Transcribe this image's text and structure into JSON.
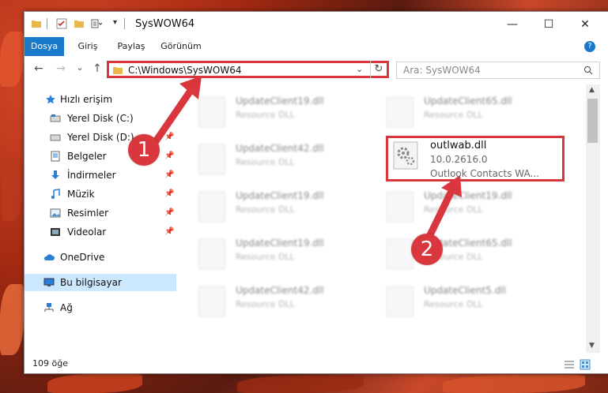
{
  "window": {
    "title": "SysWOW64",
    "controls": {
      "minimize": "—",
      "maximize": "☐",
      "close": "✕"
    }
  },
  "ribbon": {
    "tabs": [
      {
        "label": "Dosya",
        "active": true
      },
      {
        "label": "Giriş"
      },
      {
        "label": "Paylaş"
      },
      {
        "label": "Görünüm"
      }
    ],
    "help": "?"
  },
  "navigation": {
    "back": "←",
    "forward": "→",
    "recent": "⌄",
    "up": "↑",
    "address": "C:\\Windows\\SysWOW64",
    "dropdown": "⌄",
    "refresh": "↻",
    "search_placeholder": "Ara: SysWOW64"
  },
  "sidebar": {
    "items": [
      {
        "label": "Hızlı erişim",
        "icon": "star-icon"
      },
      {
        "label": "Yerel Disk (C:)",
        "icon": "drive-icon"
      },
      {
        "label": "Yerel Disk (D:)",
        "icon": "drive-icon"
      },
      {
        "label": "Belgeler",
        "icon": "documents-icon"
      },
      {
        "label": "İndirmeler",
        "icon": "download-icon"
      },
      {
        "label": "Müzik",
        "icon": "music-icon"
      },
      {
        "label": "Resimler",
        "icon": "pictures-icon"
      },
      {
        "label": "Videolar",
        "icon": "videos-icon"
      },
      {
        "label": "OneDrive",
        "icon": "cloud-icon"
      },
      {
        "label": "Bu bilgisayar",
        "icon": "computer-icon",
        "selected": true
      },
      {
        "label": "Ağ",
        "icon": "network-icon"
      }
    ]
  },
  "files": [
    {
      "name": "UpdateClient19.dll",
      "desc": "Resource DLL"
    },
    {
      "name": "UpdateClient65.dll",
      "desc": "Resource DLL"
    },
    {
      "name": "UpdateClient42.dll",
      "desc": "Resource DLL"
    },
    {
      "name": "outlwab.dll",
      "version": "10.0.2616.0",
      "desc": "Outlook Contacts WA..."
    },
    {
      "name": "UpdateClient19.dll",
      "desc": "Resource DLL"
    },
    {
      "name": "UpdateClient19.dll",
      "desc": "Resource DLL"
    },
    {
      "name": "UpdateClient19.dll",
      "desc": "Resource DLL"
    },
    {
      "name": "UpdateClient65.dll",
      "desc": "Resource DLL"
    },
    {
      "name": "UpdateClient42.dll",
      "desc": "Resource DLL"
    },
    {
      "name": "UpdateClient5.dll",
      "desc": "Resource DLL"
    }
  ],
  "status": {
    "count": "109 öğe"
  },
  "markers": {
    "one": "1",
    "two": "2"
  },
  "colors": {
    "accent": "#1979ca",
    "highlight": "#d9363e",
    "selected": "#cce8ff"
  }
}
